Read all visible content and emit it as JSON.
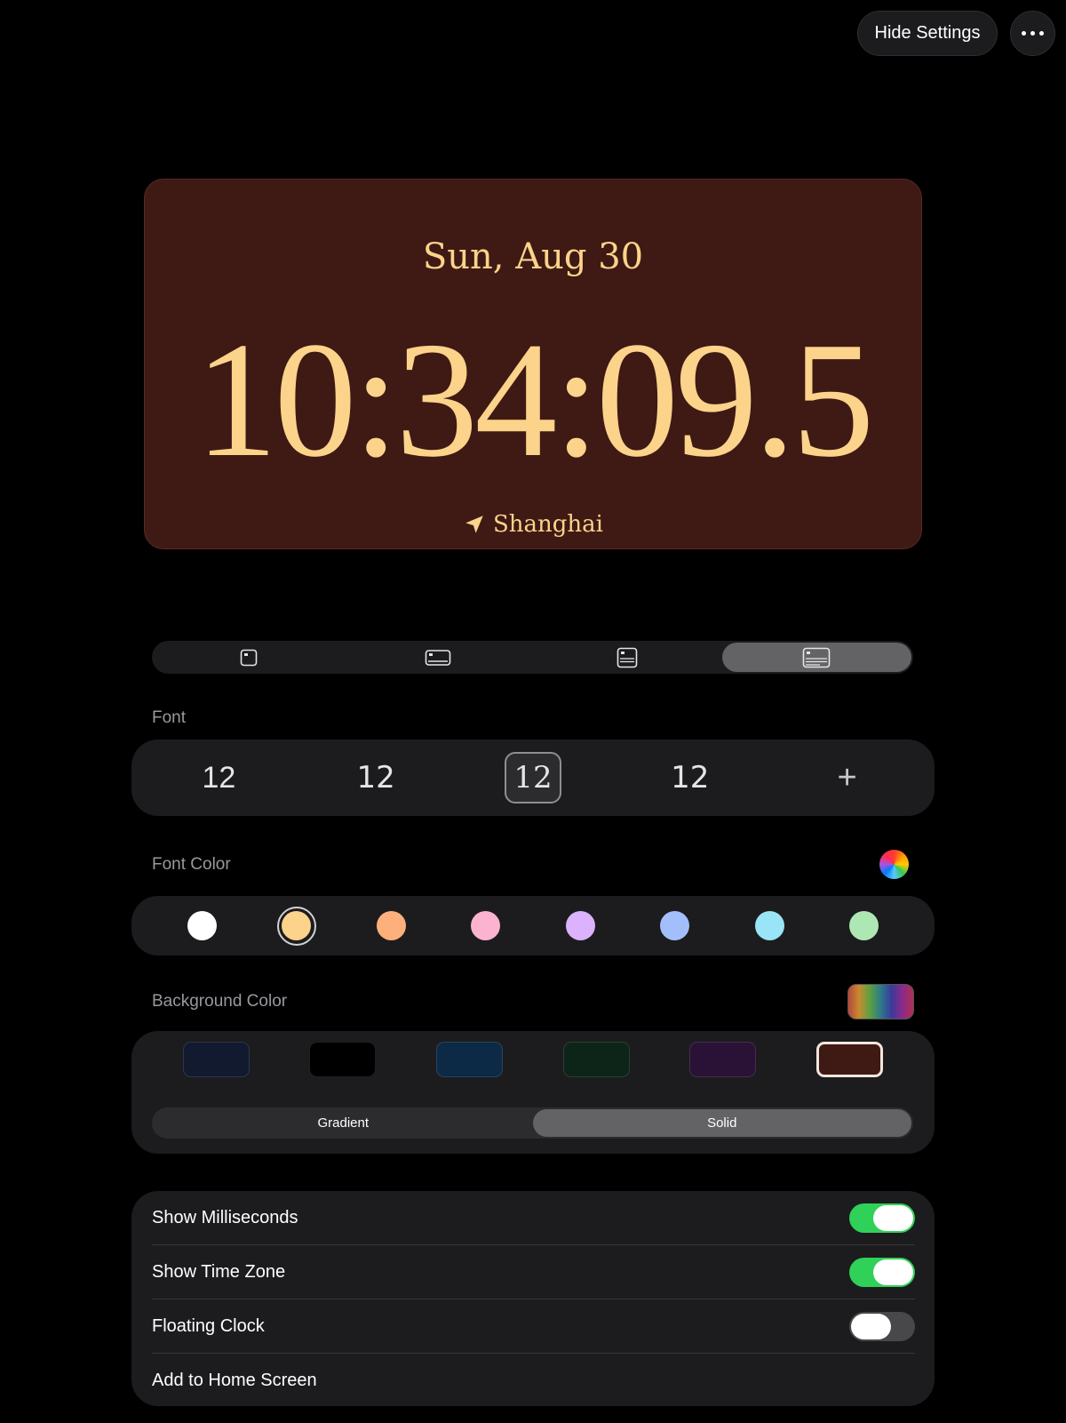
{
  "header": {
    "hide_settings_label": "Hide Settings",
    "more_icon": "ellipsis-icon"
  },
  "clock": {
    "date": "Sun, Aug 30",
    "time": "10:34:09.5",
    "location": "Shanghai",
    "location_icon": "location-arrow-icon",
    "text_color": "#fbd38a",
    "background_color": "#3f1914"
  },
  "layout_options": {
    "icons": [
      "layout-small-icon",
      "layout-wide-icon",
      "layout-detail-icon",
      "layout-full-icon"
    ],
    "selected_index": 3
  },
  "font": {
    "label": "Font",
    "options": [
      "12",
      "12",
      "12",
      "12"
    ],
    "selected_index": 2,
    "add_label": "+"
  },
  "font_color": {
    "label": "Font Color",
    "picker_icon": "color-wheel-icon",
    "swatches": [
      "#ffffff",
      "#fbd38a",
      "#fdb07b",
      "#fbb3cf",
      "#dbb2fb",
      "#a3bffb",
      "#9ae4f7",
      "#ade8b4"
    ],
    "selected_index": 1
  },
  "background_color": {
    "label": "Background Color",
    "picker_icon": "gradient-picker-icon",
    "swatches": [
      "#121a30",
      "#000000",
      "#0c2a45",
      "#0d2418",
      "#2a1236",
      "#3f1914"
    ],
    "selected_index": 5,
    "styles": [
      "Gradient",
      "Solid"
    ],
    "selected_style_index": 1
  },
  "settings": {
    "rows": [
      {
        "label": "Show Milliseconds",
        "on": true
      },
      {
        "label": "Show Time Zone",
        "on": true
      },
      {
        "label": "Floating Clock",
        "on": false
      },
      {
        "label": "Add to Home Screen"
      }
    ]
  }
}
